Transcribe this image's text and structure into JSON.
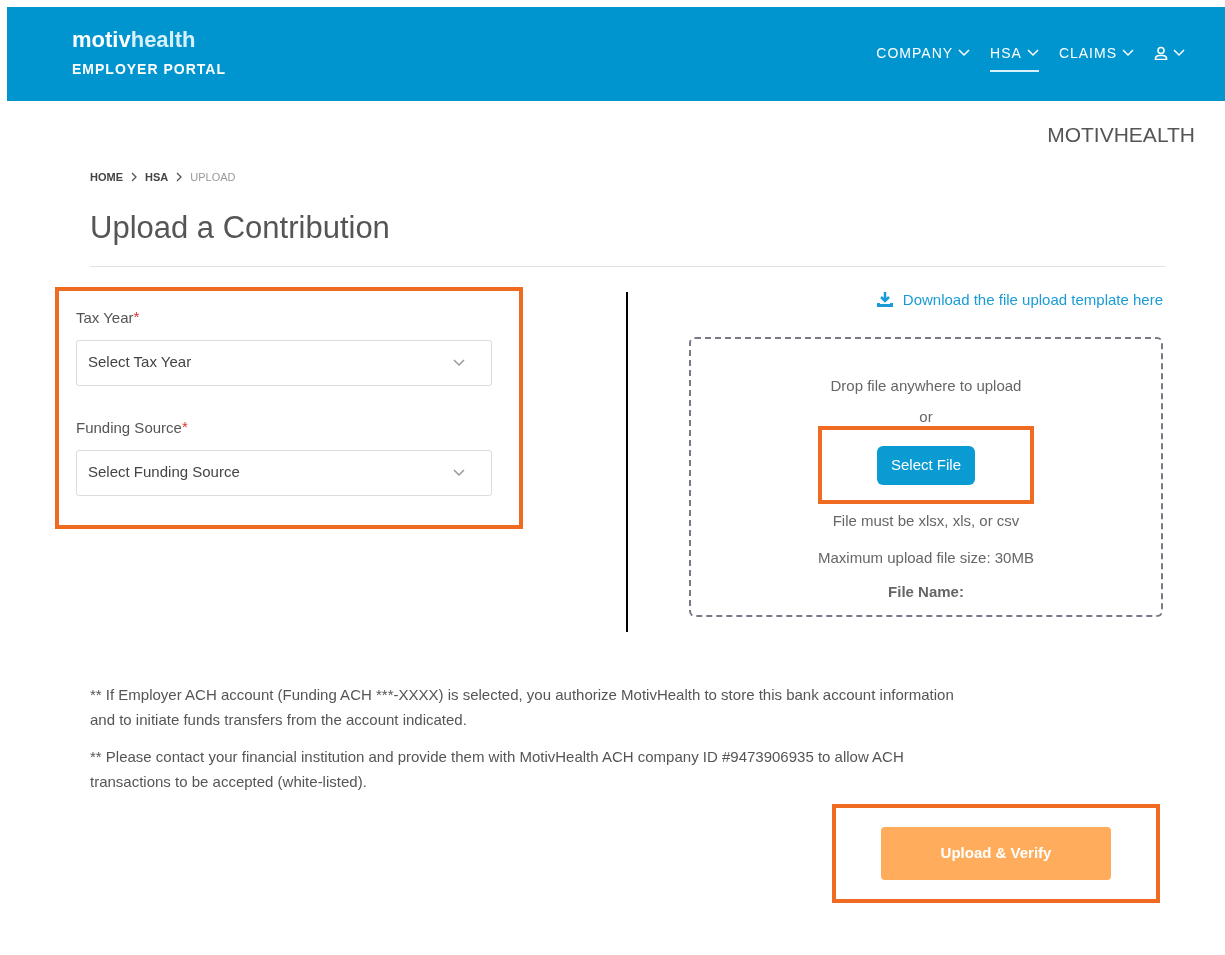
{
  "header": {
    "logo": {
      "brand_bold": "motiv",
      "brand_light": "health",
      "subtitle": "EMPLOYER PORTAL"
    },
    "nav": [
      {
        "label": "COMPANY",
        "kind": "text",
        "selected": false
      },
      {
        "label": "HSA",
        "kind": "text",
        "selected": true
      },
      {
        "label": "CLAIMS",
        "kind": "text",
        "selected": false
      },
      {
        "kind": "user",
        "selected": false
      }
    ]
  },
  "company_name": "MOTIVHEALTH",
  "breadcrumb": [
    {
      "label": "HOME",
      "current": false
    },
    {
      "label": "HSA",
      "current": false
    },
    {
      "label": "UPLOAD",
      "current": true
    }
  ],
  "title": "Upload a Contribution",
  "form": {
    "highlighted": true,
    "fields": [
      {
        "label": "Tax Year",
        "required_mark": "*",
        "placeholder": "Select Tax Year"
      },
      {
        "label": "Funding Source",
        "required_mark": "*",
        "placeholder": "Select Funding Source"
      }
    ]
  },
  "upload": {
    "template_link": "Download the file upload template here",
    "drop_text": "Drop file anywhere to upload",
    "or_text": "or",
    "select_button": {
      "label": "Select File",
      "highlighted": true
    },
    "hints": [
      "File must be xlsx, xls, or csv",
      "Maximum upload file size: 30MB"
    ],
    "file_name_label": "File Name:"
  },
  "notes": [
    "** If Employer ACH account (Funding ACH ***-XXXX) is selected, you authorize MotivHealth to store this bank account information and to initiate funds transfers from the account indicated.",
    "** Please contact your financial institution and provide them with MotivHealth ACH company ID #9473906935 to allow ACH transactions to be accepted (white-listed)."
  ],
  "submit": {
    "label": "Upload & Verify",
    "disabled": true,
    "highlighted": true
  }
}
